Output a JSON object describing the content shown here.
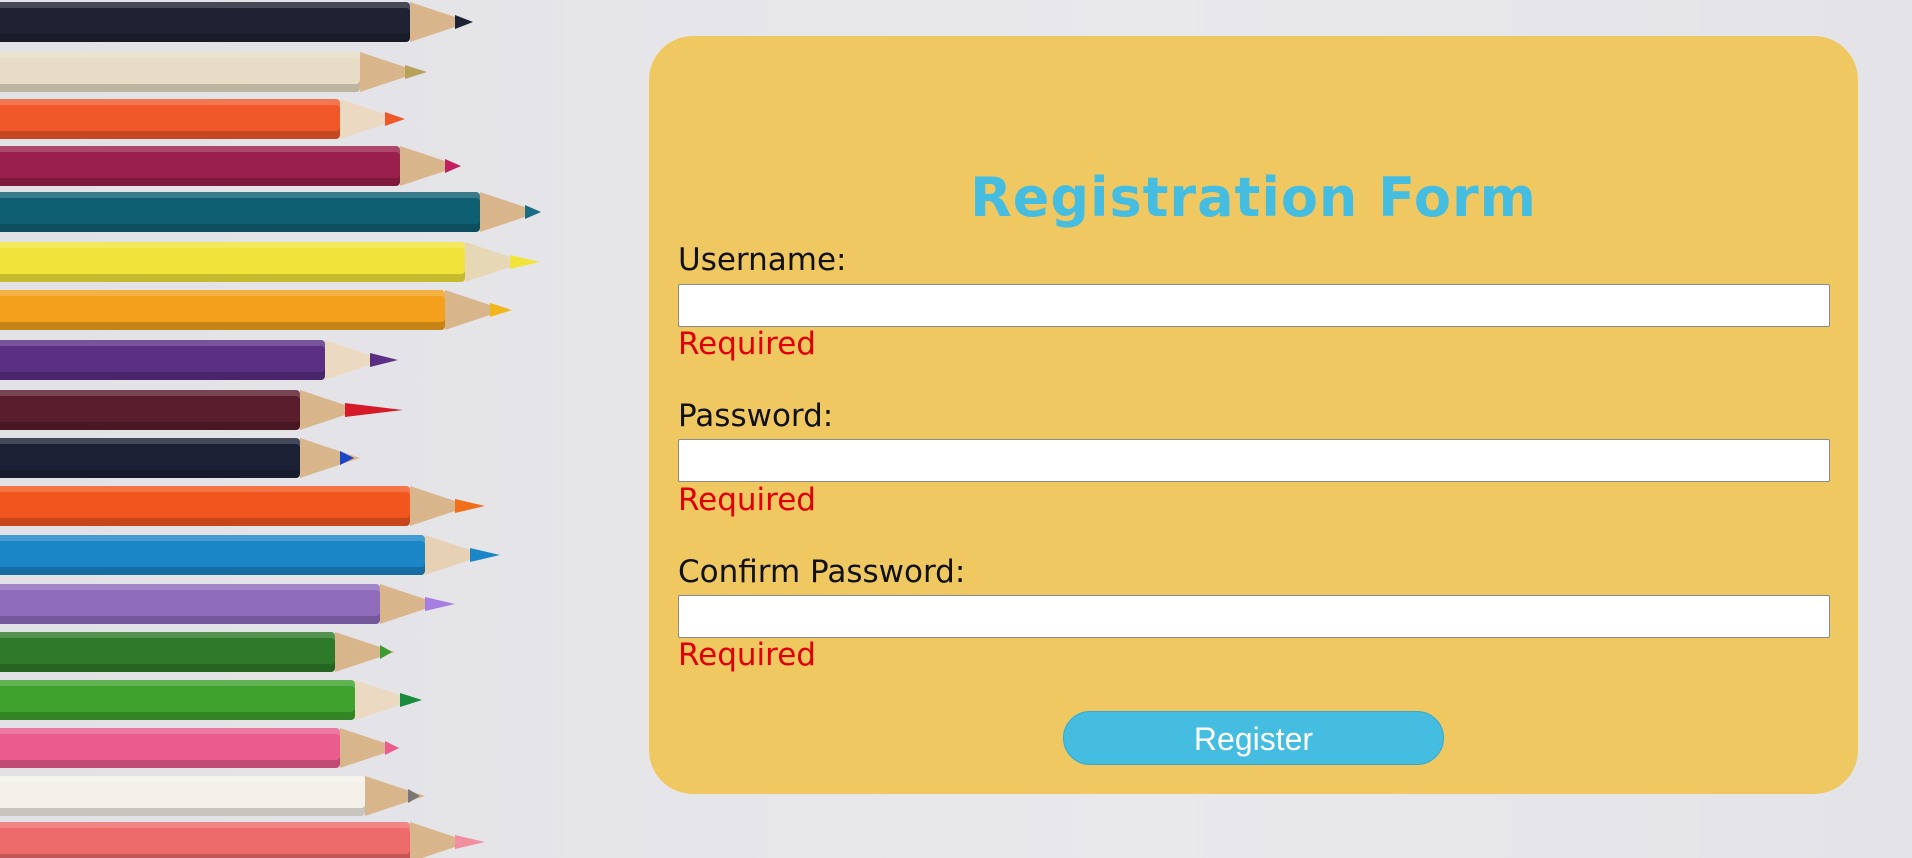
{
  "background": {
    "image": "colored-pencils-photo"
  },
  "form": {
    "title": "Registration Form",
    "fields": [
      {
        "label": "Username:",
        "value": "",
        "error": "Required"
      },
      {
        "label": "Password:",
        "value": "",
        "error": "Required"
      },
      {
        "label": "Confirm Password:",
        "value": "",
        "error": "Required"
      }
    ],
    "submit_label": "Register"
  },
  "colors": {
    "card": "#efc862",
    "accent": "#45bde0",
    "error": "#e00000"
  }
}
